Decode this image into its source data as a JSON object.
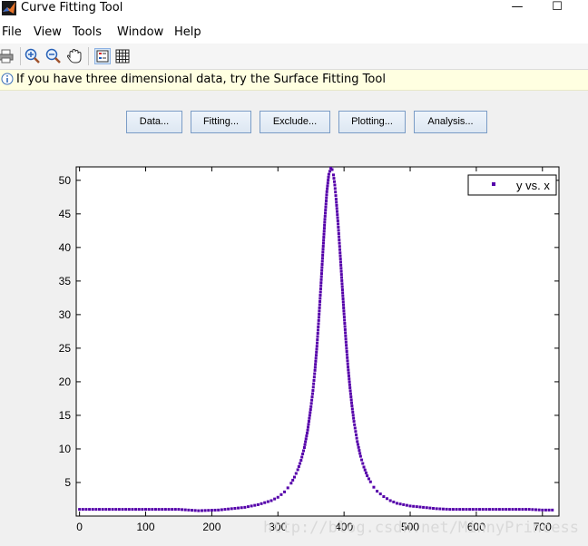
{
  "window": {
    "title": "Curve Fitting Tool",
    "minimize_glyph": "—",
    "maximize_glyph": "☐"
  },
  "menu": [
    "File",
    "View",
    "Tools",
    "Window",
    "Help"
  ],
  "toolbar": {
    "icons": [
      "print-icon",
      "zoom-in-icon",
      "zoom-out-icon",
      "pan-hand-icon",
      "legend-toggle-icon",
      "grid-toggle-icon"
    ]
  },
  "infobar": {
    "text": "If you have three dimensional data, try the Surface Fitting Tool"
  },
  "buttons": {
    "data": "Data...",
    "fitting": "Fitting...",
    "exclude": "Exclude...",
    "plotting": "Plotting...",
    "analysis": "Analysis..."
  },
  "colors": {
    "marker": "#5500aa",
    "info_bg": "#ffffe1"
  },
  "watermark": "http://blog.csdn.net/MinnyPrincess",
  "chart_data": {
    "type": "scatter",
    "title": "",
    "xlabel": "",
    "ylabel": "",
    "xlim": [
      -5,
      725
    ],
    "ylim": [
      0,
      52
    ],
    "xticks": [
      0,
      100,
      200,
      300,
      400,
      500,
      600,
      700
    ],
    "yticks": [
      5,
      10,
      15,
      20,
      25,
      30,
      35,
      40,
      45,
      50
    ],
    "grid": false,
    "legend_position": "top-right",
    "series": [
      {
        "name": "y vs. x",
        "marker": "dot",
        "color": "#5500aa",
        "x": [
          0,
          30,
          60,
          90,
          120,
          150,
          180,
          210,
          230,
          250,
          260,
          270,
          280,
          290,
          300,
          305,
          310,
          315,
          320,
          325,
          330,
          335,
          340,
          345,
          350,
          353,
          356,
          359,
          362,
          365,
          368,
          371,
          374,
          377,
          380,
          382,
          384,
          386,
          388,
          391,
          394,
          397,
          400,
          403,
          406,
          409,
          412,
          415,
          420,
          425,
          430,
          435,
          440,
          445,
          450,
          460,
          470,
          480,
          490,
          500,
          520,
          540,
          560,
          580,
          600,
          620,
          640,
          660,
          680,
          700,
          715
        ],
        "y": [
          1.0,
          1.0,
          1.0,
          1.0,
          1.0,
          1.0,
          0.8,
          0.9,
          1.1,
          1.3,
          1.5,
          1.7,
          2.0,
          2.3,
          2.8,
          3.2,
          3.6,
          4.2,
          4.9,
          5.8,
          6.9,
          8.3,
          10.2,
          12.8,
          16.3,
          18.7,
          21.7,
          25.3,
          29.6,
          34.3,
          39.3,
          44.2,
          48.3,
          50.9,
          51.8,
          51.6,
          50.8,
          49.3,
          47.2,
          43.5,
          39.2,
          34.6,
          30.1,
          25.9,
          22.2,
          19.1,
          16.4,
          14.1,
          11.1,
          8.9,
          7.3,
          6.0,
          5.1,
          4.3,
          3.7,
          2.9,
          2.3,
          1.9,
          1.7,
          1.5,
          1.3,
          1.1,
          1.0,
          1.0,
          1.0,
          1.0,
          1.0,
          1.0,
          1.0,
          0.9,
          0.9
        ]
      }
    ]
  }
}
